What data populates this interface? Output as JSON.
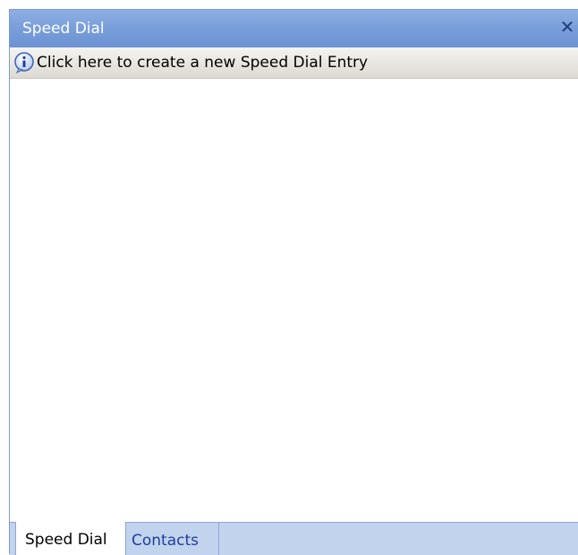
{
  "window": {
    "title": "Speed Dial",
    "close_glyph": "✕"
  },
  "info_bar": {
    "icon": "info-icon",
    "text": "Click here to create a new Speed Dial Entry"
  },
  "tabs": [
    {
      "label": "Speed Dial",
      "active": true
    },
    {
      "label": "Contacts",
      "active": false
    }
  ],
  "colors": {
    "title_bar": "#7a9fdb",
    "tab_strip": "#c2d3ee",
    "inactive_tab_text": "#1f3f9a"
  }
}
